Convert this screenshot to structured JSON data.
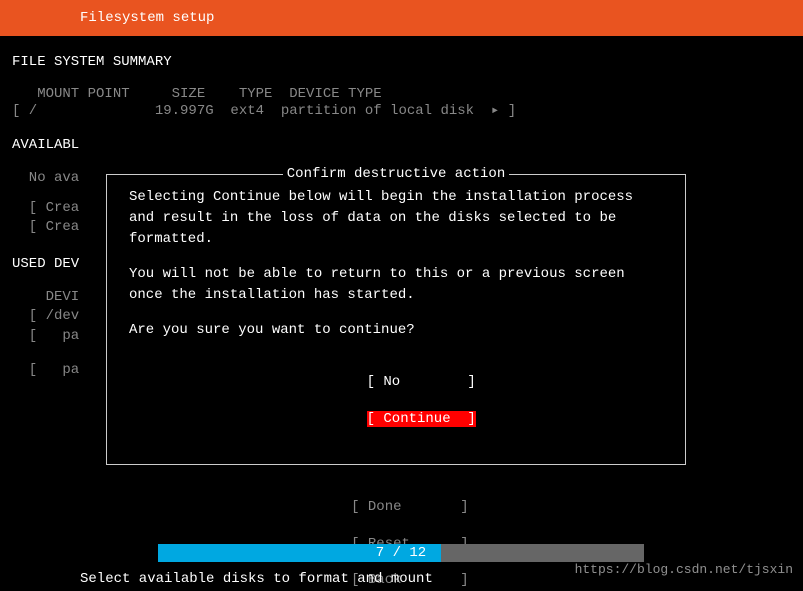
{
  "header": {
    "title": "Filesystem setup"
  },
  "summary": {
    "title": "FILE SYSTEM SUMMARY",
    "columns": "   MOUNT POINT     SIZE    TYPE  DEVICE TYPE",
    "row": "[ /              19.997G  ext4  partition of local disk  ▸ ]"
  },
  "available": {
    "title": "AVAILABL",
    "noava": "  No ava",
    "crea1": "  [ Crea",
    "crea2": "  [ Crea"
  },
  "used": {
    "title": "USED DEV",
    "devi": "    DEVI",
    "dev": "  [ /dev",
    "pa1": "  [   pa",
    "pa2": "  [   pa"
  },
  "dialog": {
    "title": "Confirm destructive action",
    "para1": "Selecting Continue below will begin the installation process and result in the loss of data on the disks selected to be formatted.",
    "para2": "You will not be able to return to this or a previous screen once the installation has started.",
    "para3": "Are you sure you want to continue?",
    "btn_no": "[ No        ]",
    "btn_continue": "[ Continue  ]"
  },
  "footer_buttons": {
    "done": "[ Done       ]",
    "reset": "[ Reset      ]",
    "back": "[ Back       ]"
  },
  "progress": {
    "text": "7 / 12"
  },
  "footer": {
    "instruction": "Select available disks to format and mount"
  },
  "watermark": "https://blog.csdn.net/tjsxin"
}
